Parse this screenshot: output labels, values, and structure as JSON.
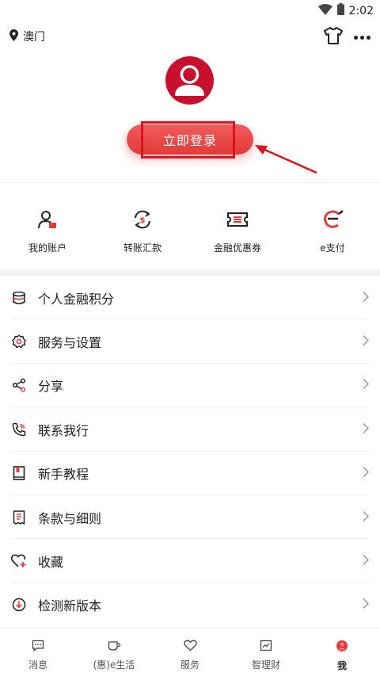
{
  "status_bar": {
    "time": "2:02"
  },
  "header": {
    "location": "澳门"
  },
  "login": {
    "button_label": "立即登录"
  },
  "quick_actions": [
    {
      "label": "我的账户",
      "icon": "account-icon"
    },
    {
      "label": "转账汇款",
      "icon": "transfer-icon"
    },
    {
      "label": "金融优惠券",
      "icon": "coupon-icon"
    },
    {
      "label": "e支付",
      "icon": "epay-icon"
    }
  ],
  "menu": [
    {
      "label": "个人金融积分",
      "icon": "database-icon"
    },
    {
      "label": "服务与设置",
      "icon": "gear-icon"
    },
    {
      "label": "分享",
      "icon": "share-icon"
    },
    {
      "label": "联系我行",
      "icon": "phone-icon"
    },
    {
      "label": "新手教程",
      "icon": "book-icon"
    },
    {
      "label": "条款与细则",
      "icon": "document-icon"
    },
    {
      "label": "收藏",
      "icon": "heart-plus-icon"
    },
    {
      "label": "检测新版本",
      "icon": "download-icon"
    }
  ],
  "tabs": [
    {
      "label": "消息",
      "icon": "message-icon"
    },
    {
      "label": "(惠)e生活",
      "icon": "cup-icon"
    },
    {
      "label": "服务",
      "icon": "heart-icon"
    },
    {
      "label": "智理财",
      "icon": "chart-icon"
    },
    {
      "label": "我",
      "icon": "me-icon",
      "active": true
    }
  ],
  "colors": {
    "accent": "#e23b3b",
    "annotation": "#e0101b"
  }
}
